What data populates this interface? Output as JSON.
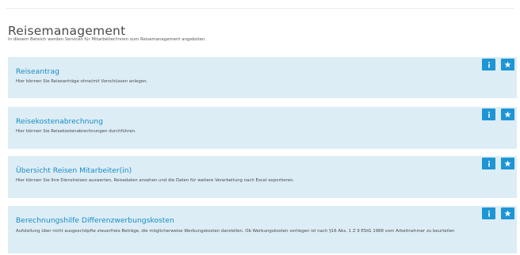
{
  "page": {
    "title": "Reisemanagement",
    "description": "In diesem Bereich werden Services für Mitarbeiter/innen zum Reisemanagement angeboten."
  },
  "cards": [
    {
      "title": "Reiseantrag",
      "description": "Hier können Sie Reiseanträge ohne/mit Vorschüssen anlegen.",
      "icons": [
        "info-icon",
        "star-icon"
      ]
    },
    {
      "title": "Reisekostenabrechnung",
      "description": "Hier können Sie Reisekostenabrechnungen durchführen.",
      "icons": [
        "info-icon",
        "star-icon"
      ]
    },
    {
      "title": "Übersicht Reisen Mitarbeiter(in)",
      "description": "Hier können Sie Ihre Dienstreisen auswerten, Reisedaten ansehen und die Daten für weitere Verarbeitung nach Excel exportieren.",
      "icons": [
        "info-icon",
        "star-icon"
      ]
    },
    {
      "title": "Berechnungshilfe Differenzwerbungskosten",
      "description": "Aufstellung über nicht ausgeschöpfte steuerfreie Beträge, die möglicherweise Werbungskosten darstellen. Ob Werbungskosten vorliegen ist nach §16 Abs. 1 Z 9 EStG 1988 vom Arbeitnehmer zu beurteilen",
      "icons": [
        "info-icon",
        "star-icon"
      ]
    }
  ],
  "colors": {
    "accent": "#1e95d4",
    "card_background": "#dcedf6",
    "link_title": "#1a8cc4"
  }
}
